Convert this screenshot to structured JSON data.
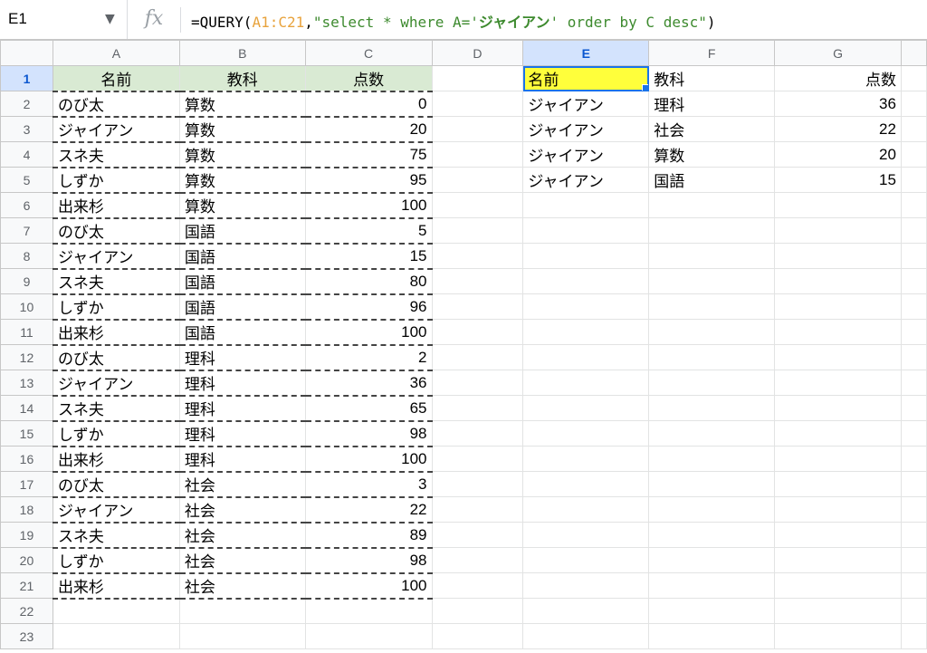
{
  "name_box": "E1",
  "fx_label": "fx",
  "formula": {
    "prefix": "=QUERY(",
    "range": "A1:C21",
    "sep": ",",
    "str1": "\"select * where A='",
    "bold": "ジャイアン",
    "str2": "' order by C desc\"",
    "suffix": ")"
  },
  "columns": [
    "A",
    "B",
    "C",
    "D",
    "E",
    "F",
    "G"
  ],
  "headers": {
    "name": "名前",
    "subject": "教科",
    "score": "点数"
  },
  "rows": [
    {
      "n": "1",
      "a": "名前",
      "b": "教科",
      "c": "点数",
      "e": "名前",
      "f": "教科",
      "g": "点数"
    },
    {
      "n": "2",
      "a": "のび太",
      "b": "算数",
      "c": "0",
      "e": "ジャイアン",
      "f": "理科",
      "g": "36"
    },
    {
      "n": "3",
      "a": "ジャイアン",
      "b": "算数",
      "c": "20",
      "e": "ジャイアン",
      "f": "社会",
      "g": "22"
    },
    {
      "n": "4",
      "a": "スネ夫",
      "b": "算数",
      "c": "75",
      "e": "ジャイアン",
      "f": "算数",
      "g": "20"
    },
    {
      "n": "5",
      "a": "しずか",
      "b": "算数",
      "c": "95",
      "e": "ジャイアン",
      "f": "国語",
      "g": "15"
    },
    {
      "n": "6",
      "a": "出来杉",
      "b": "算数",
      "c": "100"
    },
    {
      "n": "7",
      "a": "のび太",
      "b": "国語",
      "c": "5"
    },
    {
      "n": "8",
      "a": "ジャイアン",
      "b": "国語",
      "c": "15"
    },
    {
      "n": "9",
      "a": "スネ夫",
      "b": "国語",
      "c": "80"
    },
    {
      "n": "10",
      "a": "しずか",
      "b": "国語",
      "c": "96"
    },
    {
      "n": "11",
      "a": "出来杉",
      "b": "国語",
      "c": "100"
    },
    {
      "n": "12",
      "a": "のび太",
      "b": "理科",
      "c": "2"
    },
    {
      "n": "13",
      "a": "ジャイアン",
      "b": "理科",
      "c": "36"
    },
    {
      "n": "14",
      "a": "スネ夫",
      "b": "理科",
      "c": "65"
    },
    {
      "n": "15",
      "a": "しずか",
      "b": "理科",
      "c": "98"
    },
    {
      "n": "16",
      "a": "出来杉",
      "b": "理科",
      "c": "100"
    },
    {
      "n": "17",
      "a": "のび太",
      "b": "社会",
      "c": "3"
    },
    {
      "n": "18",
      "a": "ジャイアン",
      "b": "社会",
      "c": "22"
    },
    {
      "n": "19",
      "a": "スネ夫",
      "b": "社会",
      "c": "89"
    },
    {
      "n": "20",
      "a": "しずか",
      "b": "社会",
      "c": "98"
    },
    {
      "n": "21",
      "a": "出来杉",
      "b": "社会",
      "c": "100"
    },
    {
      "n": "22"
    },
    {
      "n": "23"
    }
  ]
}
